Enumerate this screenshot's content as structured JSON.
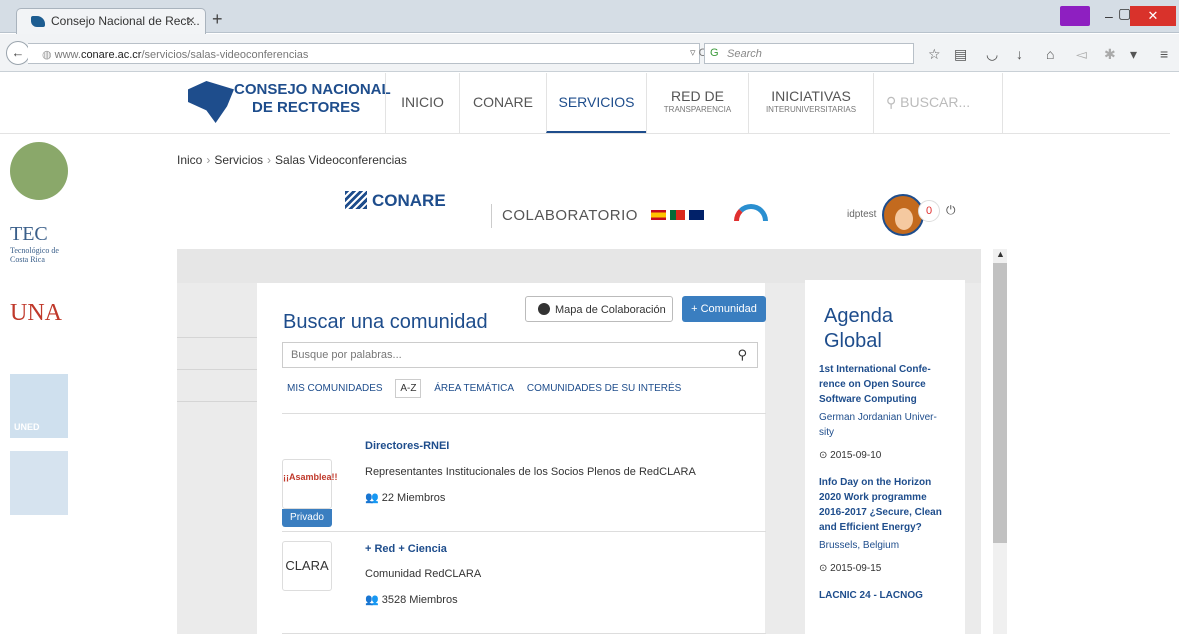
{
  "browser": {
    "tab_title": "Consejo Nacional de Rect...",
    "url_prefix": "www.",
    "url_domain": "conare.ac.cr",
    "url_path": "/servicios/salas-videoconferencias",
    "search_placeholder": "Search"
  },
  "header": {
    "logo_line1": "CONSEJO NACIONAL",
    "logo_line2": "DE RECTORES",
    "menu": [
      {
        "label": "INICIO"
      },
      {
        "label": "CONARE"
      },
      {
        "label": "SERVICIOS"
      },
      {
        "label": "RED DE",
        "sub": "TRANSPARENCIA"
      },
      {
        "label": "INICIATIVAS",
        "sub": "INTERUNIVERSITARIAS"
      }
    ],
    "search_label": "BUSCAR..."
  },
  "universities": [
    "TEC",
    "Tecnológico de Costa Rica",
    "UNA",
    "UNED"
  ],
  "breadcrumb": [
    "Inico",
    "Servicios",
    "Salas Videoconferencias"
  ],
  "colab": {
    "brand": "CONARE",
    "title": "COLABORATORIO",
    "user": "idptest",
    "notifications": "0"
  },
  "search": {
    "title": "Buscar una comunidad",
    "map_button": "Mapa de Colaboración",
    "add_button": "+ Comunidad",
    "input_placeholder": "Busque por palabras...",
    "tabs": [
      "MIS COMUNIDADES",
      "A-Z",
      "ÁREA TEMÁTICA",
      "COMUNIDADES DE SU INTERÉS"
    ]
  },
  "communities": [
    {
      "name": "Directores-RNEI",
      "desc": "Representantes Institucionales de los Socios Plenos de RedCLARA",
      "members": "22 Miembros",
      "badge": "Privado",
      "logo_text": "¡¡Asamblea!!"
    },
    {
      "name": "+ Red + Ciencia",
      "desc": "Comunidad RedCLARA",
      "members": "3528 Miembros",
      "logo_text": "CLARA"
    }
  ],
  "agenda": {
    "title": "Agenda Global",
    "events": [
      {
        "title": "1st International Confe-rence on Open Source Software Computing",
        "location": "German Jordanian Univer-sity",
        "date": "2015-09-10"
      },
      {
        "title": "Info Day on the Horizon 2020 Work programme 2016-2017 ¿Secure, Clean and Efficient Energy?",
        "location": "Brussels, Belgium",
        "date": "2015-09-15"
      },
      {
        "title": "LACNIC 24 - LACNOG"
      }
    ]
  }
}
